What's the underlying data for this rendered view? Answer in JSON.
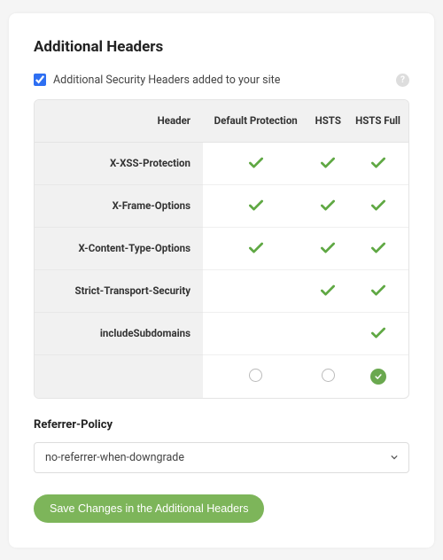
{
  "title": "Additional Headers",
  "checkbox": {
    "checked": true,
    "label": "Additional Security Headers added to your site"
  },
  "table": {
    "header_label": "Header",
    "columns": [
      "Default Protection",
      "HSTS",
      "HSTS Full"
    ],
    "rows": [
      {
        "label": "X-XSS-Protection",
        "cells": [
          true,
          true,
          true
        ]
      },
      {
        "label": "X-Frame-Options",
        "cells": [
          true,
          true,
          true
        ]
      },
      {
        "label": "X-Content-Type-Options",
        "cells": [
          true,
          true,
          true
        ]
      },
      {
        "label": "Strict-Transport-Security",
        "cells": [
          false,
          true,
          true
        ]
      },
      {
        "label": "includeSubdomains",
        "cells": [
          false,
          false,
          true
        ]
      }
    ],
    "selected_column": 2
  },
  "referrer": {
    "label": "Referrer-Policy",
    "value": "no-referrer-when-downgrade"
  },
  "save_button": "Save Changes in the Additional Headers"
}
